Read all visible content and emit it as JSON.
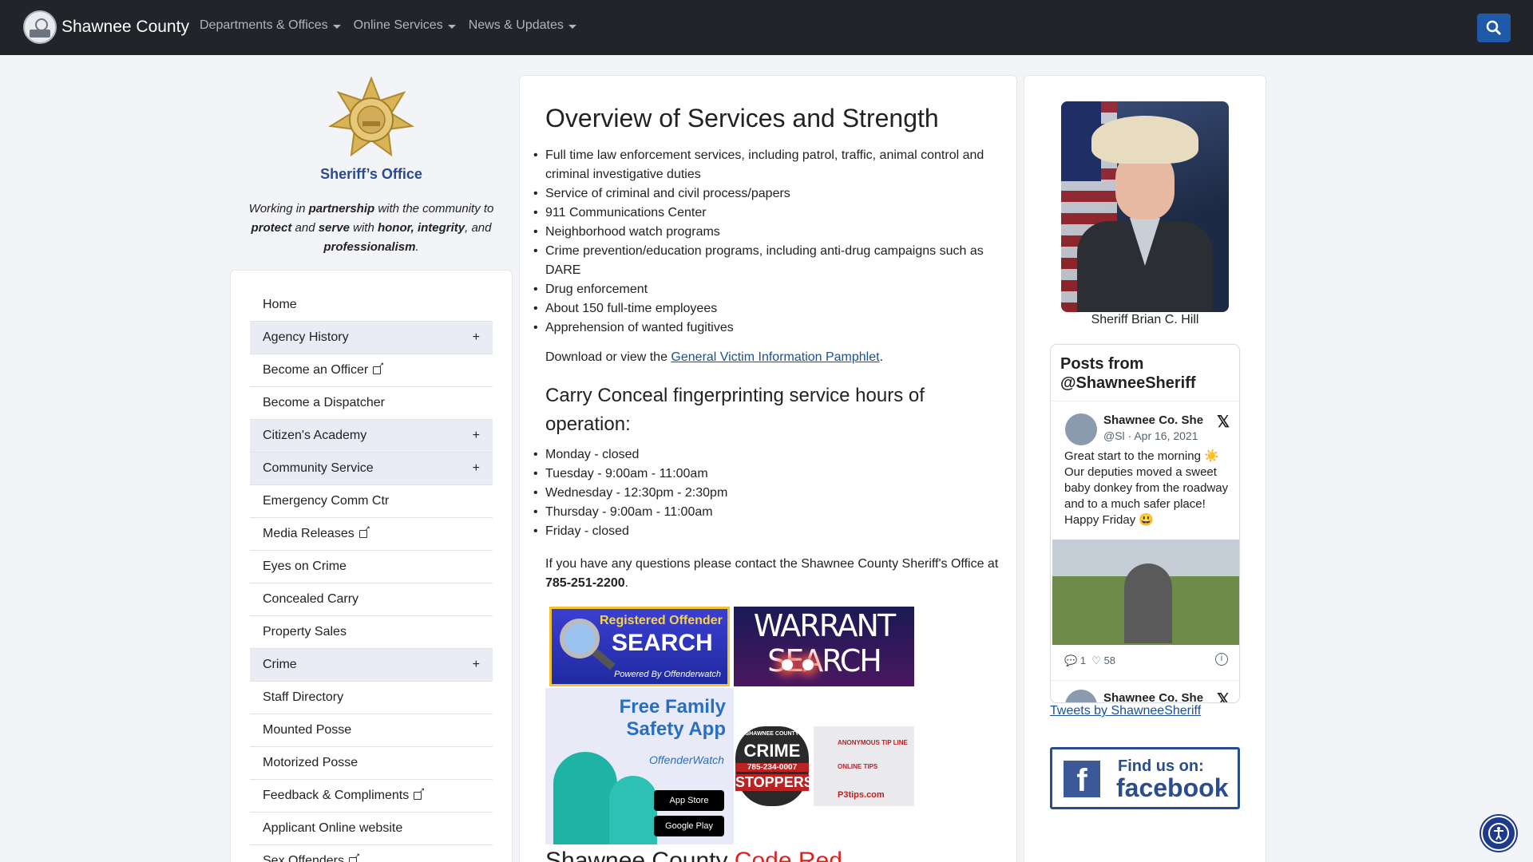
{
  "navbar": {
    "brand": "Shawnee County",
    "menu": [
      {
        "label": "Departments & Offices"
      },
      {
        "label": "Online Services"
      },
      {
        "label": "News & Updates"
      }
    ]
  },
  "sidebar": {
    "office_name": "Sheriff’s Office",
    "mission": {
      "p1": "Working in ",
      "b1": "partnership",
      "p2": " with the community to ",
      "b2": "protect",
      "p3": " and ",
      "b3": "serve",
      "p4": " with ",
      "b4": "honor, integrity",
      "p5": ", and ",
      "b5": "professionalism",
      "p6": "."
    },
    "items": [
      {
        "label": "Home"
      },
      {
        "label": "Agency History",
        "toggle": "+"
      },
      {
        "label": "Become an Officer"
      },
      {
        "label": "Become a Dispatcher"
      },
      {
        "label": "Citizen's Academy",
        "toggle": "+"
      },
      {
        "label": "Community Service",
        "toggle": "+"
      },
      {
        "label": "Emergency Comm Ctr"
      },
      {
        "label": "Media Releases"
      },
      {
        "label": "Eyes on Crime"
      },
      {
        "label": "Concealed Carry"
      },
      {
        "label": "Property Sales"
      },
      {
        "label": "Crime",
        "toggle": "+"
      },
      {
        "label": "Staff Directory"
      },
      {
        "label": "Mounted Posse"
      },
      {
        "label": "Motorized Posse"
      },
      {
        "label": "Feedback & Compliments"
      },
      {
        "label": "Applicant Online website"
      },
      {
        "label": "Sex Offenders"
      }
    ]
  },
  "main": {
    "title": "Overview of Services and Strength",
    "services": [
      "Full time law enforcement services, including patrol, traffic, animal control and criminal investigative duties",
      "Service of criminal and civil process/papers",
      "911 Communications Center",
      "Neighborhood watch programs",
      "Crime prevention/education programs, including anti-drug campaigns such as DARE",
      "Drug enforcement",
      "About 150 full-time employees",
      "Apprehension of wanted fugitives"
    ],
    "download_prefix": "Download or view the ",
    "download_link": "General Victim Information Pamphlet",
    "download_suffix": ".",
    "carry_title": "Carry Conceal fingerprinting service hours of operation:",
    "hours": [
      "Monday - closed",
      "Tuesday - 9:00am - 11:00am",
      "Wednesday - 12:30pm - 2:30pm",
      "Thursday - 9:00am - 11:00am",
      "Friday - closed"
    ],
    "contact_text": "If you have any questions please contact the Shawnee County Sheriff's Office at ",
    "contact_phone": "785-251-2200",
    "contact_suffix": ".",
    "banners": {
      "offender_line1": "Registered Offender",
      "offender_line2": "SEARCH",
      "offender_powered": "Powered By Offenderwatch",
      "warrant": "WARRANT SEARCH",
      "family_line1": "Free Family",
      "family_line2": "Safety App",
      "family_brand": "OffenderWatch",
      "app_store": "App Store",
      "google_play": "Google Play",
      "crime_county": "SHAWNEE COUNTY",
      "crime_line1": "CRIME",
      "crime_phone": "785-234-0007",
      "crime_line2": "STOPPERS",
      "crime_tip_line": "ANONYMOUS TIP LINE",
      "crime_online": "ONLINE TIPS",
      "crime_app": "P3tips.com"
    },
    "bottom_heading_prefix": "Shawnee County ",
    "bottom_heading_red": "Code Red"
  },
  "right": {
    "caption": "Sheriff Brian C. Hill",
    "twitter": {
      "header": "Posts from @ShawneeSheriff",
      "author": "Shawnee Co. She",
      "handle": "@Sl · Apr 16, 2021",
      "text": "Great start to the morning ☀️ Our deputies moved a sweet baby donkey from the roadway and to a much safer place! Happy Friday 😃",
      "replies": "1",
      "likes": "58",
      "author2": "Shawnee Co. She",
      "link": "Tweets by ShawneeSheriff"
    },
    "facebook": {
      "line1": "Find us on:",
      "line2": "facebook"
    }
  }
}
